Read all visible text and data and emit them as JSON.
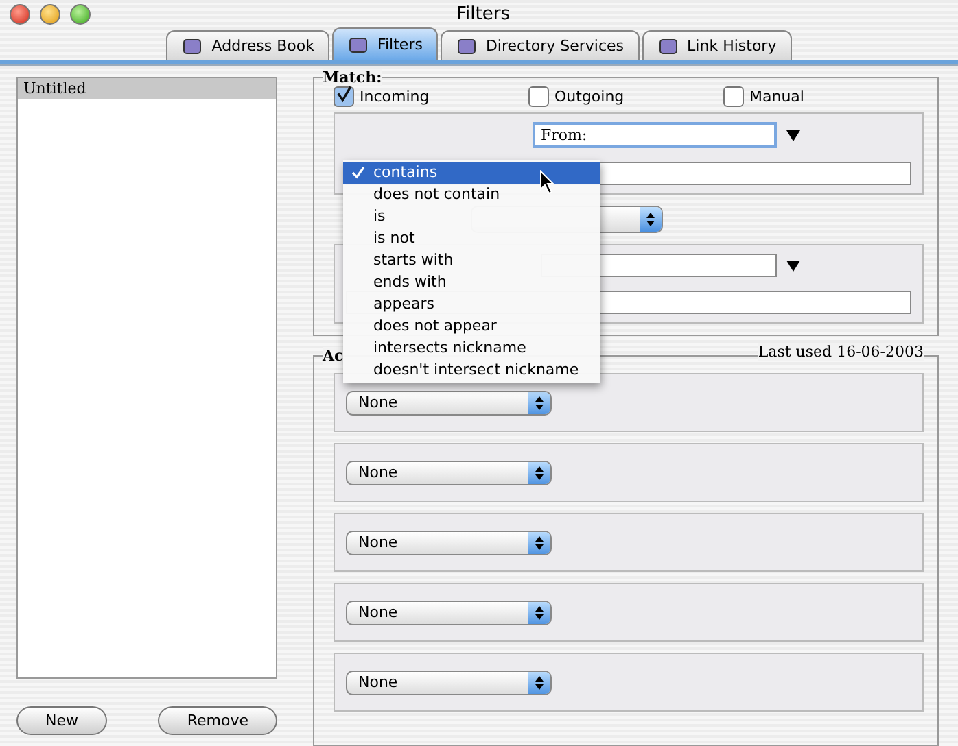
{
  "window": {
    "title": "Filters"
  },
  "tabs": [
    {
      "label": "Address Book",
      "selected": false
    },
    {
      "label": "Filters",
      "selected": true
    },
    {
      "label": "Directory Services",
      "selected": false
    },
    {
      "label": "Link History",
      "selected": false
    }
  ],
  "filter_list": {
    "items": [
      {
        "label": "Untitled",
        "selected": true
      }
    ]
  },
  "list_buttons": [
    "New",
    "Remove"
  ],
  "match": {
    "title": "Match:",
    "options": [
      {
        "label": "Incoming",
        "checked": true
      },
      {
        "label": "Outgoing",
        "checked": false
      },
      {
        "label": "Manual",
        "checked": false
      }
    ],
    "field": "From:"
  },
  "condition_menu": {
    "items": [
      {
        "label": "contains",
        "selected": true
      },
      {
        "label": "does not contain",
        "selected": false
      },
      {
        "label": "is",
        "selected": false
      },
      {
        "label": "is not",
        "selected": false
      },
      {
        "label": "starts with",
        "selected": false
      },
      {
        "label": "ends with",
        "selected": false
      },
      {
        "label": "appears",
        "selected": false
      },
      {
        "label": "does not appear",
        "selected": false
      },
      {
        "label": "intersects nickname",
        "selected": false
      },
      {
        "label": "doesn't intersect nickname",
        "selected": false
      }
    ]
  },
  "actions": {
    "title": "Ac",
    "last_used": "Last used 16-06-2003",
    "rows": [
      "None",
      "None",
      "None",
      "None",
      "None"
    ]
  }
}
